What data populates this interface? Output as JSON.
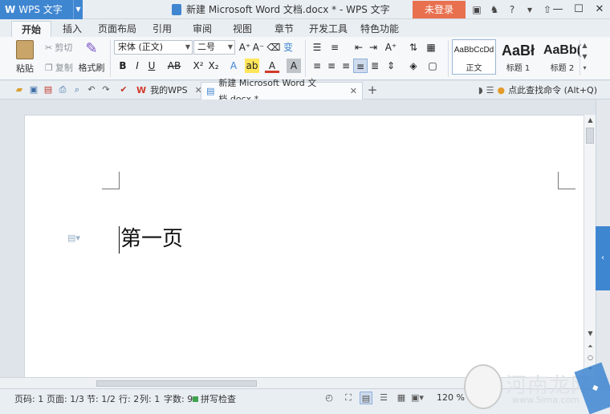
{
  "titlebar": {
    "app_button": "WPS 文字",
    "doc_title": "新建 Microsoft Word 文档.docx * - WPS 文字",
    "login": "未登录"
  },
  "menu": [
    "开始",
    "插入",
    "页面布局",
    "引用",
    "审阅",
    "视图",
    "章节",
    "开发工具",
    "特色功能"
  ],
  "ribbon": {
    "paste": "粘贴",
    "cut": "剪切",
    "copy": "复制",
    "format_painter": "格式刷",
    "font_name": "宋体 (正文)",
    "font_size": "二号",
    "styles": [
      {
        "preview": "AaBbCcDd",
        "name": "正文"
      },
      {
        "preview": "AaBł",
        "name": "标题 1"
      },
      {
        "preview": "AaBb(",
        "name": "标题 2"
      }
    ]
  },
  "doc_tabs": {
    "mywps": "我的WPS",
    "active": "新建 Microsoft Word 文档.docx *",
    "find_command": "点此查找命令 (Alt+Q)"
  },
  "document": {
    "text": "第一页"
  },
  "status": {
    "page": "页码: 1",
    "pages": "页面: 1/3",
    "section": "节: 1/2",
    "row": "行: 2",
    "col": "列: 1",
    "words": "字数: 9",
    "spell": "拼写检查",
    "zoom": "120 %"
  },
  "watermark": {
    "text": "河南龙网",
    "url": "www.5ima.com"
  },
  "colors": {
    "accent": "#3f86d1",
    "login": "#e8704f"
  }
}
